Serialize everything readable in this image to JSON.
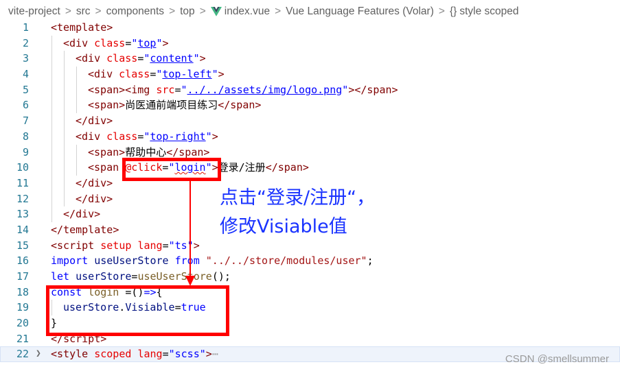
{
  "breadcrumb": {
    "items": [
      "vite-project",
      "src",
      "components",
      "top",
      "index.vue",
      "Vue Language Features (Volar)",
      "style scoped"
    ],
    "separator": ">",
    "file_icon": "vue-logo-icon",
    "symbol_icon": "braces-icon",
    "symbol_glyph": "{}"
  },
  "editor": {
    "current_line": 22,
    "lines": [
      {
        "n": 1,
        "indent": 0,
        "tokens": [
          [
            "p",
            "<"
          ],
          [
            "t",
            "template"
          ],
          [
            "p",
            ">"
          ]
        ]
      },
      {
        "n": 2,
        "indent": 1,
        "tokens": [
          [
            "p",
            "<"
          ],
          [
            "t",
            "div"
          ],
          [
            "x",
            " "
          ],
          [
            "a",
            "class"
          ],
          [
            "x",
            "="
          ],
          [
            "s",
            "\""
          ],
          [
            "l",
            "top"
          ],
          [
            "s",
            "\""
          ],
          [
            "p",
            ">"
          ]
        ]
      },
      {
        "n": 3,
        "indent": 2,
        "tokens": [
          [
            "p",
            "<"
          ],
          [
            "t",
            "div"
          ],
          [
            "x",
            " "
          ],
          [
            "a",
            "class"
          ],
          [
            "x",
            "="
          ],
          [
            "s",
            "\""
          ],
          [
            "l",
            "content"
          ],
          [
            "s",
            "\""
          ],
          [
            "p",
            ">"
          ]
        ]
      },
      {
        "n": 4,
        "indent": 3,
        "tokens": [
          [
            "p",
            "<"
          ],
          [
            "t",
            "div"
          ],
          [
            "x",
            " "
          ],
          [
            "a",
            "class"
          ],
          [
            "x",
            "="
          ],
          [
            "s",
            "\""
          ],
          [
            "l",
            "top-left"
          ],
          [
            "s",
            "\""
          ],
          [
            "p",
            ">"
          ]
        ]
      },
      {
        "n": 5,
        "indent": 3,
        "tokens": [
          [
            "p",
            "<"
          ],
          [
            "t",
            "span"
          ],
          [
            "p",
            "><"
          ],
          [
            "t",
            "img"
          ],
          [
            "x",
            " "
          ],
          [
            "a",
            "src"
          ],
          [
            "x",
            "="
          ],
          [
            "s",
            "\""
          ],
          [
            "l",
            "../../assets/img/logo.png"
          ],
          [
            "s",
            "\""
          ],
          [
            "p",
            "></"
          ],
          [
            "t",
            "span"
          ],
          [
            "p",
            ">"
          ]
        ]
      },
      {
        "n": 6,
        "indent": 3,
        "tokens": [
          [
            "p",
            "<"
          ],
          [
            "t",
            "span"
          ],
          [
            "p",
            ">"
          ],
          [
            "x",
            "尚医通前端项目练习"
          ],
          [
            "p",
            "</"
          ],
          [
            "t",
            "span"
          ],
          [
            "p",
            ">"
          ]
        ]
      },
      {
        "n": 7,
        "indent": 2,
        "tokens": [
          [
            "p",
            "</"
          ],
          [
            "t",
            "div"
          ],
          [
            "p",
            ">"
          ]
        ]
      },
      {
        "n": 8,
        "indent": 2,
        "tokens": [
          [
            "p",
            "<"
          ],
          [
            "t",
            "div"
          ],
          [
            "x",
            " "
          ],
          [
            "a",
            "class"
          ],
          [
            "x",
            "="
          ],
          [
            "s",
            "\""
          ],
          [
            "l",
            "top-right"
          ],
          [
            "s",
            "\""
          ],
          [
            "p",
            ">"
          ]
        ]
      },
      {
        "n": 9,
        "indent": 3,
        "tokens": [
          [
            "p",
            "<"
          ],
          [
            "t",
            "span"
          ],
          [
            "p",
            ">"
          ],
          [
            "x",
            "帮助中心"
          ],
          [
            "p",
            "</"
          ],
          [
            "t",
            "span"
          ],
          [
            "p",
            ">"
          ]
        ]
      },
      {
        "n": 10,
        "indent": 3,
        "tokens": [
          [
            "p",
            "<"
          ],
          [
            "t",
            "span"
          ],
          [
            "x",
            " "
          ],
          [
            "a",
            "@click"
          ],
          [
            "x",
            "="
          ],
          [
            "s",
            "\""
          ],
          [
            "q",
            "login"
          ],
          [
            "s",
            "\""
          ],
          [
            "p",
            ">"
          ],
          [
            "x",
            "登录/注册"
          ],
          [
            "p",
            "</"
          ],
          [
            "t",
            "span"
          ],
          [
            "p",
            ">"
          ]
        ]
      },
      {
        "n": 11,
        "indent": 2,
        "tokens": [
          [
            "p",
            "</"
          ],
          [
            "t",
            "div"
          ],
          [
            "p",
            ">"
          ]
        ]
      },
      {
        "n": 12,
        "indent": 2,
        "tokens": [
          [
            "p",
            "</"
          ],
          [
            "t",
            "div"
          ],
          [
            "p",
            ">"
          ]
        ]
      },
      {
        "n": 13,
        "indent": 1,
        "tokens": [
          [
            "p",
            "</"
          ],
          [
            "t",
            "div"
          ],
          [
            "p",
            ">"
          ]
        ]
      },
      {
        "n": 14,
        "indent": 0,
        "tokens": [
          [
            "p",
            "</"
          ],
          [
            "t",
            "template"
          ],
          [
            "p",
            ">"
          ]
        ]
      },
      {
        "n": 15,
        "indent": 0,
        "tokens": [
          [
            "p",
            "<"
          ],
          [
            "t",
            "script"
          ],
          [
            "x",
            " "
          ],
          [
            "a",
            "setup"
          ],
          [
            "x",
            " "
          ],
          [
            "a",
            "lang"
          ],
          [
            "x",
            "="
          ],
          [
            "s",
            "\"ts\""
          ],
          [
            "p",
            ">"
          ]
        ]
      },
      {
        "n": 16,
        "indent": 0,
        "tokens": [
          [
            "k",
            "import"
          ],
          [
            "x",
            " "
          ],
          [
            "v",
            "useUserStore"
          ],
          [
            "x",
            " "
          ],
          [
            "k",
            "from"
          ],
          [
            "x",
            " "
          ],
          [
            "r",
            "\"../../store/modules/user\""
          ],
          [
            "x",
            ";"
          ]
        ]
      },
      {
        "n": 17,
        "indent": 0,
        "tokens": [
          [
            "k",
            "let"
          ],
          [
            "x",
            " "
          ],
          [
            "v",
            "userStore"
          ],
          [
            "x",
            "="
          ],
          [
            "f",
            "useUserStore"
          ],
          [
            "x",
            "();"
          ]
        ]
      },
      {
        "n": 18,
        "indent": 0,
        "tokens": [
          [
            "k",
            "const"
          ],
          [
            "x",
            " "
          ],
          [
            "f",
            "login"
          ],
          [
            "x",
            " ="
          ],
          [
            "x",
            "()"
          ],
          [
            "k",
            "=>"
          ],
          [
            "x",
            "{"
          ]
        ]
      },
      {
        "n": 19,
        "indent": 1,
        "tokens": [
          [
            "v",
            "userStore"
          ],
          [
            "x",
            "."
          ],
          [
            "v",
            "Visiable"
          ],
          [
            "x",
            "="
          ],
          [
            "k",
            "true"
          ]
        ]
      },
      {
        "n": 20,
        "indent": 0,
        "tokens": [
          [
            "x",
            "}"
          ]
        ]
      },
      {
        "n": 21,
        "indent": 0,
        "tokens": [
          [
            "p",
            "</"
          ],
          [
            "t",
            "script"
          ],
          [
            "p",
            ">"
          ]
        ]
      },
      {
        "n": 22,
        "indent": 0,
        "fold": true,
        "tokens": [
          [
            "p",
            "<"
          ],
          [
            "t",
            "style"
          ],
          [
            "x",
            " "
          ],
          [
            "a",
            "scoped"
          ],
          [
            "x",
            " "
          ],
          [
            "a",
            "lang"
          ],
          [
            "x",
            "="
          ],
          [
            "s",
            "\"scss\""
          ],
          [
            "p",
            ">"
          ],
          [
            "g",
            "⋯"
          ]
        ]
      }
    ]
  },
  "annotation": {
    "line1": "点击“登录/注册“，",
    "line2": "修改Visiable值",
    "highlight_color": "#ff0000",
    "text_color": "#1a33ff"
  },
  "watermark": "CSDN @smellsummer"
}
